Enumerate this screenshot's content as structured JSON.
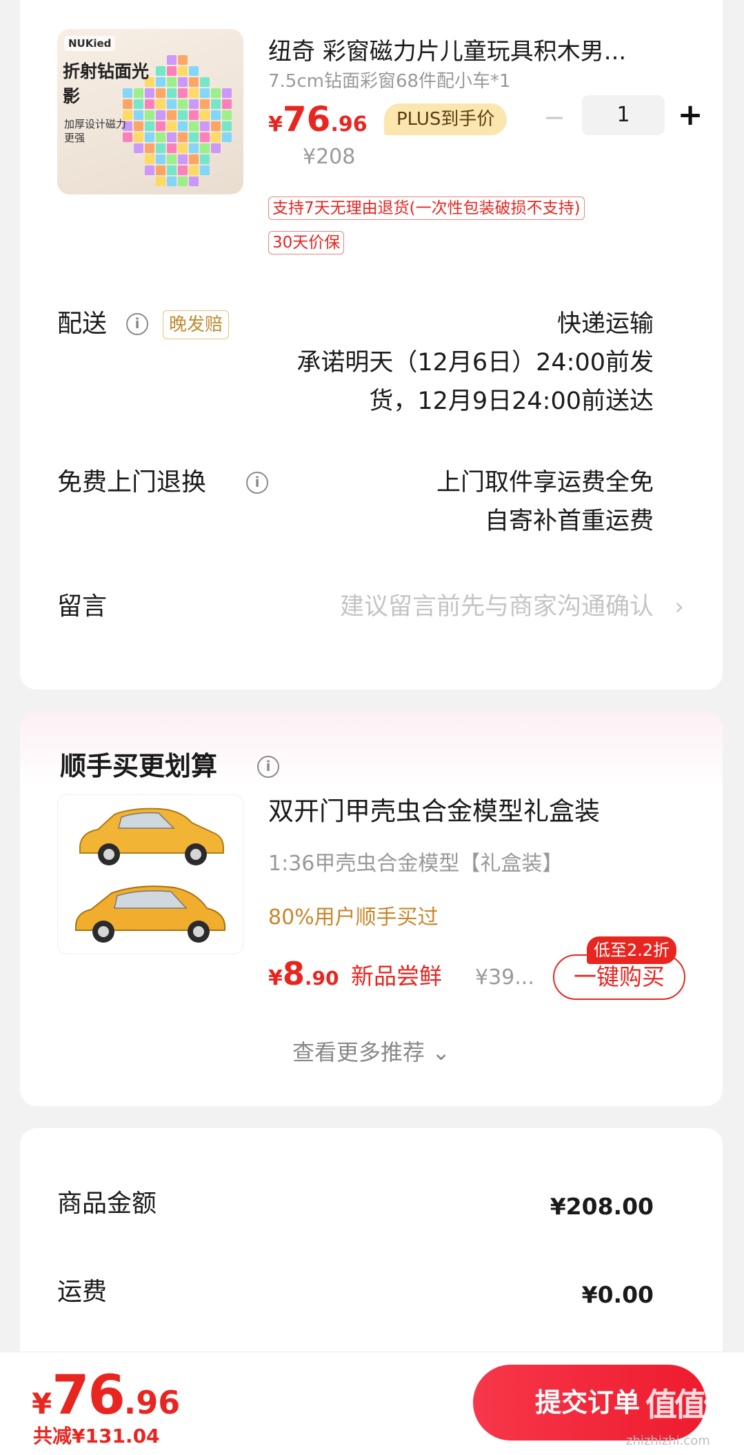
{
  "product": {
    "image_logo": "NUKied",
    "image_promo_main": "折射钻面光影",
    "image_promo_sub": "加厚设计磁力更强",
    "title": "纽奇 彩窗磁力片儿童玩具积木男...",
    "spec": "7.5cm钻面彩窗68件配小车*1",
    "price_yen": "¥",
    "price_int": "76",
    "price_dec": ".96",
    "plus_badge": "PLUS到手价",
    "minus_symbol": "−",
    "quantity": "1",
    "plus_symbol": "+",
    "original_price": "¥208",
    "tags": [
      "支持7天无理由退货(一次性包装破损不支持)",
      "30天价保"
    ]
  },
  "delivery": {
    "label": "配送",
    "info_icon": "i",
    "late_badge": "晚发赔",
    "method": "快递运输",
    "promise_line1": "承诺明天（12月6日）24:00前发",
    "promise_line2": "货，12月9日24:00前送达"
  },
  "free_return": {
    "label": "免费上门退换",
    "info_icon": "i",
    "line1": "上门取件享运费全免",
    "line2": "自寄补首重运费"
  },
  "message": {
    "label": "留言",
    "placeholder": "建议留言前先与商家沟通确认",
    "chevron": "›"
  },
  "addon": {
    "title": "顺手买更划算",
    "info_icon": "i",
    "name": "双开门甲壳虫合金模型礼盒装",
    "spec": "1:36甲壳虫合金模型【礼盒装】",
    "users": "80%用户顺手买过",
    "price_yen": "¥",
    "price_int": "8",
    "price_dec": ".90",
    "new_tag": "新品尝鲜",
    "orig_price": "¥39...",
    "discount": "低至2.2折",
    "buy_label": "一键购买",
    "see_more": "查看更多推荐",
    "see_more_chevron": "⌄"
  },
  "summary": {
    "goods_label": "商品金额",
    "goods_value": "¥208.00",
    "shipping_label": "运费",
    "shipping_value": "¥0.00"
  },
  "bottom": {
    "yen": "¥",
    "int": "76",
    "dec": ".96",
    "reduce": "共减¥131.04",
    "submit": "提交订单",
    "watermark": "值值值",
    "watermark_url": "zhizhizhi.com"
  },
  "colors": {
    "accent_red": "#e8251f",
    "plus_gold": "#fbe6b0",
    "orange_text": "#c9852b"
  }
}
